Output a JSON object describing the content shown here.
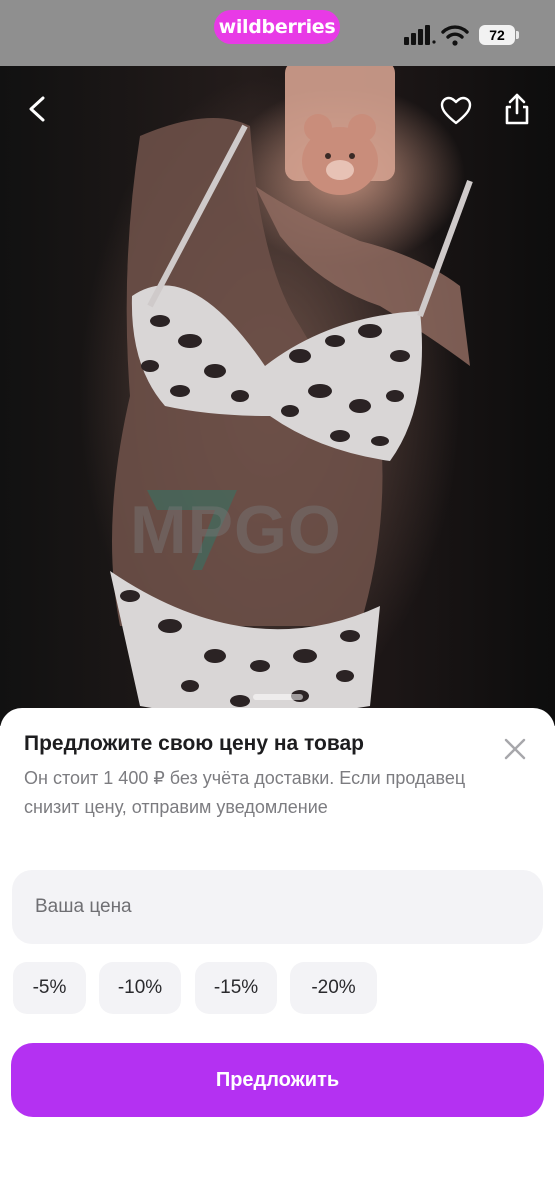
{
  "status_bar": {
    "app_name": "wildberries",
    "battery": "72",
    "colors": {
      "app_pill": "#e83ae6",
      "background": "#8f8f8f"
    }
  },
  "product_photo": {
    "watermark": "MPGO",
    "icons": [
      "back-icon",
      "heart-icon",
      "share-icon"
    ]
  },
  "sheet": {
    "title": "Предложите свою цену на товар",
    "description": "Он стоит 1 400 ₽ без учёта доставки. Если продавец снизит цену, отправим уведомление",
    "price_input": {
      "placeholder": "Ваша цена",
      "value": ""
    },
    "discount_chips": [
      "-5%",
      "-10%",
      "-15%",
      "-20%"
    ],
    "submit_label": "Предложить",
    "colors": {
      "submit": "#b431f2",
      "chip_bg": "#f3f3f6"
    }
  }
}
